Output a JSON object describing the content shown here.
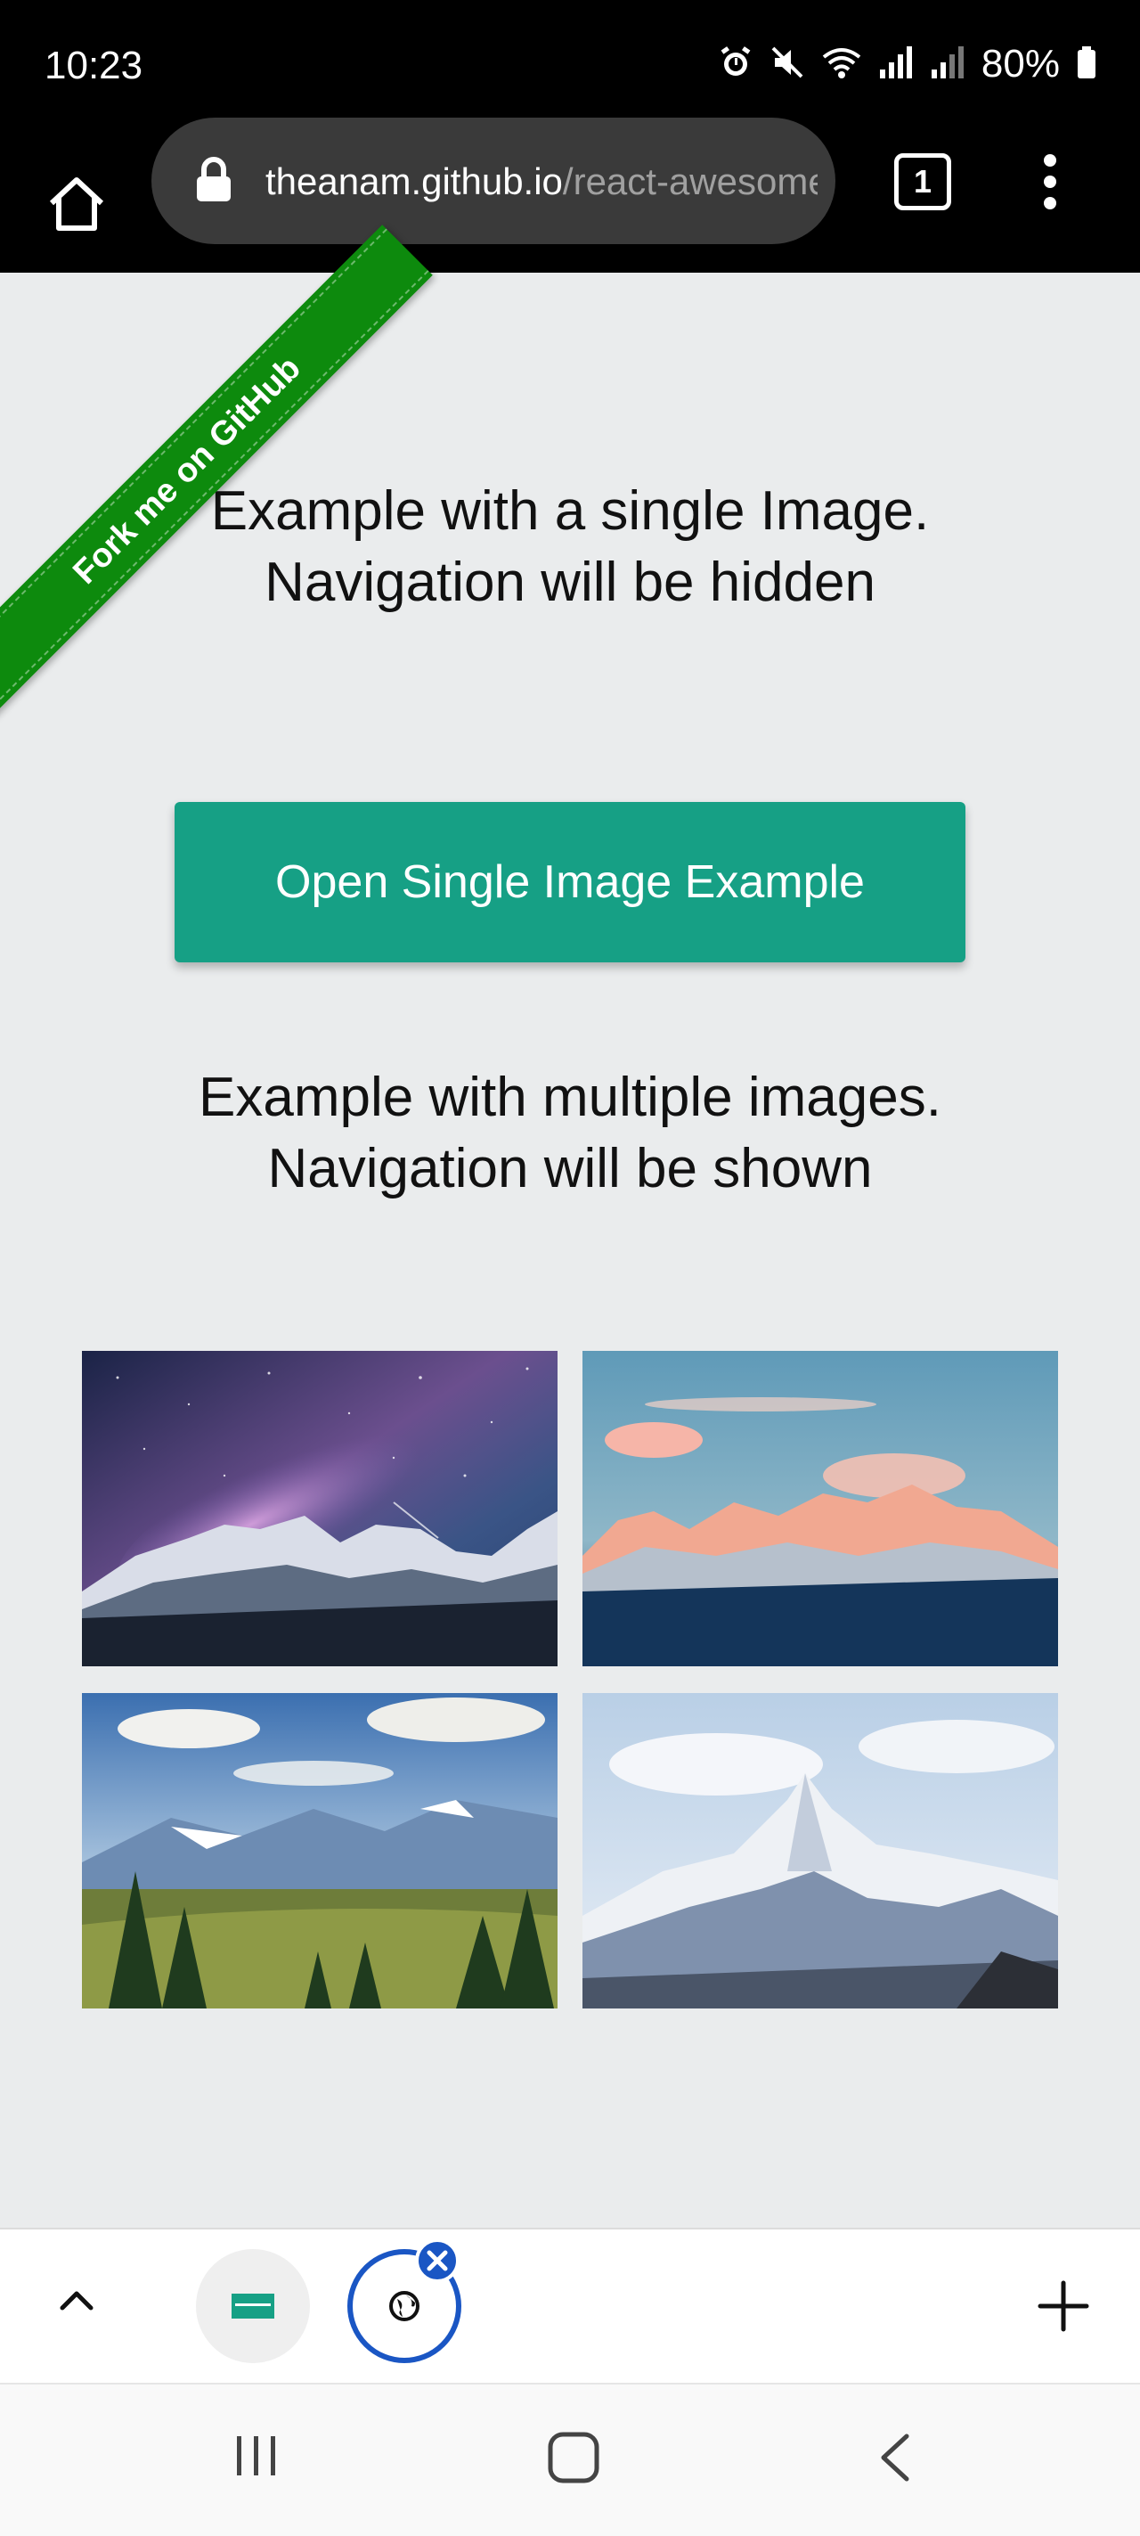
{
  "status_bar": {
    "time": "10:23",
    "battery": "80%",
    "icons": [
      "alarm-icon",
      "mute-icon",
      "wifi-icon",
      "signal-icon",
      "signal-weak-icon",
      "battery-icon"
    ]
  },
  "toolbar": {
    "url_host": "theanam.github.io",
    "url_path": "/react-awesome-lightbox",
    "tab_count": "1",
    "icons": [
      "home-icon",
      "lock-icon",
      "tabs-icon",
      "more-icon"
    ]
  },
  "ribbon": {
    "label": "Fork me on GitHub",
    "color": "#0d8a0d"
  },
  "content": {
    "single_heading": "Example with a single Image. Navigation will be hidden",
    "single_button": "Open Single Image Example",
    "multiple_heading": "Example with multiple images. Navigation will be shown",
    "accent_color": "#16a085",
    "thumbnails": [
      "milky-way-mountains",
      "sunset-peaks",
      "forest-valley",
      "snowy-summit"
    ]
  },
  "tab_strip": {
    "icons": [
      "chevron-up-icon",
      "tab-thumbnail-icon",
      "globe-icon",
      "close-icon",
      "plus-icon"
    ]
  },
  "nav_bar": {
    "icons": [
      "recents-icon",
      "home-button-icon",
      "back-icon"
    ]
  }
}
